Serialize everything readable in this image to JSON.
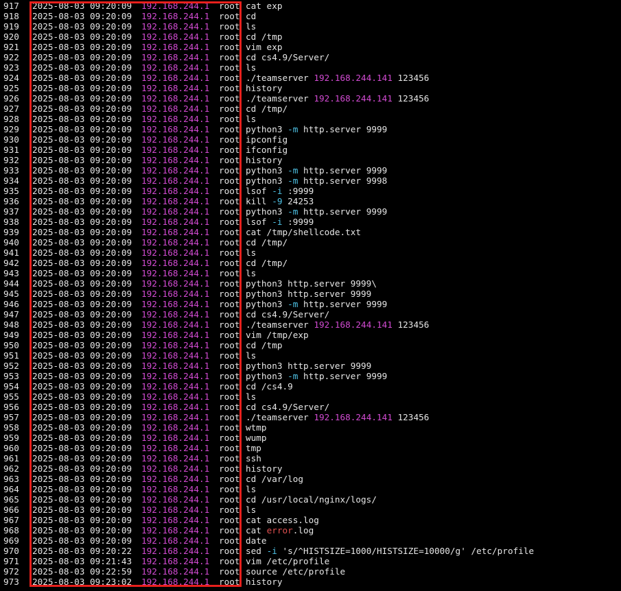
{
  "colors": {
    "background": "#000000",
    "text": "#e6e6e6",
    "ip_highlight": "#d24bd2",
    "flag_highlight": "#4fc3e6",
    "error_word": "#e05050",
    "annotation_box": "#e8201c"
  },
  "history": [
    {
      "num": "917",
      "time": "2025-08-03 09:20:09",
      "ip": "192.168.244.1",
      "user": "root",
      "cmd": [
        {
          "t": "cat exp"
        }
      ]
    },
    {
      "num": "918",
      "time": "2025-08-03 09:20:09",
      "ip": "192.168.244.1",
      "user": "root",
      "cmd": [
        {
          "t": "cd"
        }
      ]
    },
    {
      "num": "919",
      "time": "2025-08-03 09:20:09",
      "ip": "192.168.244.1",
      "user": "root",
      "cmd": [
        {
          "t": "ls"
        }
      ]
    },
    {
      "num": "920",
      "time": "2025-08-03 09:20:09",
      "ip": "192.168.244.1",
      "user": "root",
      "cmd": [
        {
          "t": "cd /tmp"
        }
      ]
    },
    {
      "num": "921",
      "time": "2025-08-03 09:20:09",
      "ip": "192.168.244.1",
      "user": "root",
      "cmd": [
        {
          "t": "vim exp"
        }
      ]
    },
    {
      "num": "922",
      "time": "2025-08-03 09:20:09",
      "ip": "192.168.244.1",
      "user": "root",
      "cmd": [
        {
          "t": "cd cs4.9/Server/"
        }
      ]
    },
    {
      "num": "923",
      "time": "2025-08-03 09:20:09",
      "ip": "192.168.244.1",
      "user": "root",
      "cmd": [
        {
          "t": "ls"
        }
      ]
    },
    {
      "num": "924",
      "time": "2025-08-03 09:20:09",
      "ip": "192.168.244.1",
      "user": "root",
      "cmd": [
        {
          "t": "./teamserver "
        },
        {
          "t": "192.168.244.141",
          "c": "ip"
        },
        {
          "t": " 123456"
        }
      ]
    },
    {
      "num": "925",
      "time": "2025-08-03 09:20:09",
      "ip": "192.168.244.1",
      "user": "root",
      "cmd": [
        {
          "t": "history"
        }
      ]
    },
    {
      "num": "926",
      "time": "2025-08-03 09:20:09",
      "ip": "192.168.244.1",
      "user": "root",
      "cmd": [
        {
          "t": "./teamserver "
        },
        {
          "t": "192.168.244.141",
          "c": "ip"
        },
        {
          "t": " 123456"
        }
      ]
    },
    {
      "num": "927",
      "time": "2025-08-03 09:20:09",
      "ip": "192.168.244.1",
      "user": "root",
      "cmd": [
        {
          "t": "cd /tmp/"
        }
      ]
    },
    {
      "num": "928",
      "time": "2025-08-03 09:20:09",
      "ip": "192.168.244.1",
      "user": "root",
      "cmd": [
        {
          "t": "ls"
        }
      ]
    },
    {
      "num": "929",
      "time": "2025-08-03 09:20:09",
      "ip": "192.168.244.1",
      "user": "root",
      "cmd": [
        {
          "t": "python3 "
        },
        {
          "t": "-m",
          "c": "flag"
        },
        {
          "t": " http.server 9999"
        }
      ]
    },
    {
      "num": "930",
      "time": "2025-08-03 09:20:09",
      "ip": "192.168.244.1",
      "user": "root",
      "cmd": [
        {
          "t": "ipconfig"
        }
      ]
    },
    {
      "num": "931",
      "time": "2025-08-03 09:20:09",
      "ip": "192.168.244.1",
      "user": "root",
      "cmd": [
        {
          "t": "ifconfig"
        }
      ]
    },
    {
      "num": "932",
      "time": "2025-08-03 09:20:09",
      "ip": "192.168.244.1",
      "user": "root",
      "cmd": [
        {
          "t": "history"
        }
      ]
    },
    {
      "num": "933",
      "time": "2025-08-03 09:20:09",
      "ip": "192.168.244.1",
      "user": "root",
      "cmd": [
        {
          "t": "python3 "
        },
        {
          "t": "-m",
          "c": "flag"
        },
        {
          "t": " http.server 9999"
        }
      ]
    },
    {
      "num": "934",
      "time": "2025-08-03 09:20:09",
      "ip": "192.168.244.1",
      "user": "root",
      "cmd": [
        {
          "t": "python3 "
        },
        {
          "t": "-m",
          "c": "flag"
        },
        {
          "t": " http.server 9998"
        }
      ]
    },
    {
      "num": "935",
      "time": "2025-08-03 09:20:09",
      "ip": "192.168.244.1",
      "user": "root",
      "cmd": [
        {
          "t": "lsof "
        },
        {
          "t": "-i",
          "c": "flag"
        },
        {
          "t": " :9999"
        }
      ]
    },
    {
      "num": "936",
      "time": "2025-08-03 09:20:09",
      "ip": "192.168.244.1",
      "user": "root",
      "cmd": [
        {
          "t": "kill "
        },
        {
          "t": "-9",
          "c": "flag"
        },
        {
          "t": " 24253"
        }
      ]
    },
    {
      "num": "937",
      "time": "2025-08-03 09:20:09",
      "ip": "192.168.244.1",
      "user": "root",
      "cmd": [
        {
          "t": "python3 "
        },
        {
          "t": "-m",
          "c": "flag"
        },
        {
          "t": " http.server 9999"
        }
      ]
    },
    {
      "num": "938",
      "time": "2025-08-03 09:20:09",
      "ip": "192.168.244.1",
      "user": "root",
      "cmd": [
        {
          "t": "lsof "
        },
        {
          "t": "-i",
          "c": "flag"
        },
        {
          "t": " :9999"
        }
      ]
    },
    {
      "num": "939",
      "time": "2025-08-03 09:20:09",
      "ip": "192.168.244.1",
      "user": "root",
      "cmd": [
        {
          "t": "cat /tmp/shellcode.txt"
        }
      ]
    },
    {
      "num": "940",
      "time": "2025-08-03 09:20:09",
      "ip": "192.168.244.1",
      "user": "root",
      "cmd": [
        {
          "t": "cd /tmp/"
        }
      ]
    },
    {
      "num": "941",
      "time": "2025-08-03 09:20:09",
      "ip": "192.168.244.1",
      "user": "root",
      "cmd": [
        {
          "t": "ls"
        }
      ]
    },
    {
      "num": "942",
      "time": "2025-08-03 09:20:09",
      "ip": "192.168.244.1",
      "user": "root",
      "cmd": [
        {
          "t": "cd /tmp/"
        }
      ]
    },
    {
      "num": "943",
      "time": "2025-08-03 09:20:09",
      "ip": "192.168.244.1",
      "user": "root",
      "cmd": [
        {
          "t": "ls"
        }
      ]
    },
    {
      "num": "944",
      "time": "2025-08-03 09:20:09",
      "ip": "192.168.244.1",
      "user": "root",
      "cmd": [
        {
          "t": "python3 http.server 9999\\"
        }
      ]
    },
    {
      "num": "945",
      "time": "2025-08-03 09:20:09",
      "ip": "192.168.244.1",
      "user": "root",
      "cmd": [
        {
          "t": "python3 http.server 9999"
        }
      ]
    },
    {
      "num": "946",
      "time": "2025-08-03 09:20:09",
      "ip": "192.168.244.1",
      "user": "root",
      "cmd": [
        {
          "t": "python3 "
        },
        {
          "t": "-m",
          "c": "flag"
        },
        {
          "t": " http.server 9999"
        }
      ]
    },
    {
      "num": "947",
      "time": "2025-08-03 09:20:09",
      "ip": "192.168.244.1",
      "user": "root",
      "cmd": [
        {
          "t": "cd cs4.9/Server/"
        }
      ]
    },
    {
      "num": "948",
      "time": "2025-08-03 09:20:09",
      "ip": "192.168.244.1",
      "user": "root",
      "cmd": [
        {
          "t": "./teamserver "
        },
        {
          "t": "192.168.244.141",
          "c": "ip"
        },
        {
          "t": " 123456"
        }
      ]
    },
    {
      "num": "949",
      "time": "2025-08-03 09:20:09",
      "ip": "192.168.244.1",
      "user": "root",
      "cmd": [
        {
          "t": "vim /tmp/exp"
        }
      ]
    },
    {
      "num": "950",
      "time": "2025-08-03 09:20:09",
      "ip": "192.168.244.1",
      "user": "root",
      "cmd": [
        {
          "t": "cd /tmp"
        }
      ]
    },
    {
      "num": "951",
      "time": "2025-08-03 09:20:09",
      "ip": "192.168.244.1",
      "user": "root",
      "cmd": [
        {
          "t": "ls"
        }
      ]
    },
    {
      "num": "952",
      "time": "2025-08-03 09:20:09",
      "ip": "192.168.244.1",
      "user": "root",
      "cmd": [
        {
          "t": "python3 http.server 9999"
        }
      ]
    },
    {
      "num": "953",
      "time": "2025-08-03 09:20:09",
      "ip": "192.168.244.1",
      "user": "root",
      "cmd": [
        {
          "t": "python3 "
        },
        {
          "t": "-m",
          "c": "flag"
        },
        {
          "t": " http.server 9999"
        }
      ]
    },
    {
      "num": "954",
      "time": "2025-08-03 09:20:09",
      "ip": "192.168.244.1",
      "user": "root",
      "cmd": [
        {
          "t": "cd /cs4.9"
        }
      ]
    },
    {
      "num": "955",
      "time": "2025-08-03 09:20:09",
      "ip": "192.168.244.1",
      "user": "root",
      "cmd": [
        {
          "t": "ls"
        }
      ]
    },
    {
      "num": "956",
      "time": "2025-08-03 09:20:09",
      "ip": "192.168.244.1",
      "user": "root",
      "cmd": [
        {
          "t": "cd cs4.9/Server/"
        }
      ]
    },
    {
      "num": "957",
      "time": "2025-08-03 09:20:09",
      "ip": "192.168.244.1",
      "user": "root",
      "cmd": [
        {
          "t": "./teamserver "
        },
        {
          "t": "192.168.244.141",
          "c": "ip"
        },
        {
          "t": " 123456"
        }
      ]
    },
    {
      "num": "958",
      "time": "2025-08-03 09:20:09",
      "ip": "192.168.244.1",
      "user": "root",
      "cmd": [
        {
          "t": "wtmp"
        }
      ]
    },
    {
      "num": "959",
      "time": "2025-08-03 09:20:09",
      "ip": "192.168.244.1",
      "user": "root",
      "cmd": [
        {
          "t": "wump"
        }
      ]
    },
    {
      "num": "960",
      "time": "2025-08-03 09:20:09",
      "ip": "192.168.244.1",
      "user": "root",
      "cmd": [
        {
          "t": "tmp"
        }
      ]
    },
    {
      "num": "961",
      "time": "2025-08-03 09:20:09",
      "ip": "192.168.244.1",
      "user": "root",
      "cmd": [
        {
          "t": "ssh"
        }
      ]
    },
    {
      "num": "962",
      "time": "2025-08-03 09:20:09",
      "ip": "192.168.244.1",
      "user": "root",
      "cmd": [
        {
          "t": "history"
        }
      ]
    },
    {
      "num": "963",
      "time": "2025-08-03 09:20:09",
      "ip": "192.168.244.1",
      "user": "root",
      "cmd": [
        {
          "t": "cd /var/log"
        }
      ]
    },
    {
      "num": "964",
      "time": "2025-08-03 09:20:09",
      "ip": "192.168.244.1",
      "user": "root",
      "cmd": [
        {
          "t": "ls"
        }
      ]
    },
    {
      "num": "965",
      "time": "2025-08-03 09:20:09",
      "ip": "192.168.244.1",
      "user": "root",
      "cmd": [
        {
          "t": "cd /usr/local/nginx/logs/"
        }
      ]
    },
    {
      "num": "966",
      "time": "2025-08-03 09:20:09",
      "ip": "192.168.244.1",
      "user": "root",
      "cmd": [
        {
          "t": "ls"
        }
      ]
    },
    {
      "num": "967",
      "time": "2025-08-03 09:20:09",
      "ip": "192.168.244.1",
      "user": "root",
      "cmd": [
        {
          "t": "cat access.log"
        }
      ]
    },
    {
      "num": "968",
      "time": "2025-08-03 09:20:09",
      "ip": "192.168.244.1",
      "user": "root",
      "cmd": [
        {
          "t": "cat "
        },
        {
          "t": "error",
          "c": "err"
        },
        {
          "t": ".log"
        }
      ]
    },
    {
      "num": "969",
      "time": "2025-08-03 09:20:09",
      "ip": "192.168.244.1",
      "user": "root",
      "cmd": [
        {
          "t": "date"
        }
      ]
    },
    {
      "num": "970",
      "time": "2025-08-03 09:20:22",
      "ip": "192.168.244.1",
      "user": "root",
      "cmd": [
        {
          "t": "sed "
        },
        {
          "t": "-i",
          "c": "flag"
        },
        {
          "t": " 's/^HISTSIZE=1000/HISTSIZE=10000/g' /etc/profile"
        }
      ]
    },
    {
      "num": "971",
      "time": "2025-08-03 09:21:43",
      "ip": "192.168.244.1",
      "user": "root",
      "cmd": [
        {
          "t": "vim /etc/profile"
        }
      ]
    },
    {
      "num": "972",
      "time": "2025-08-03 09:22:59",
      "ip": "192.168.244.1",
      "user": "root",
      "cmd": [
        {
          "t": "source /etc/profile"
        }
      ]
    },
    {
      "num": "973",
      "time": "2025-08-03 09:23:02",
      "ip": "192.168.244.1",
      "user": "root",
      "cmd": [
        {
          "t": "history"
        }
      ]
    }
  ]
}
